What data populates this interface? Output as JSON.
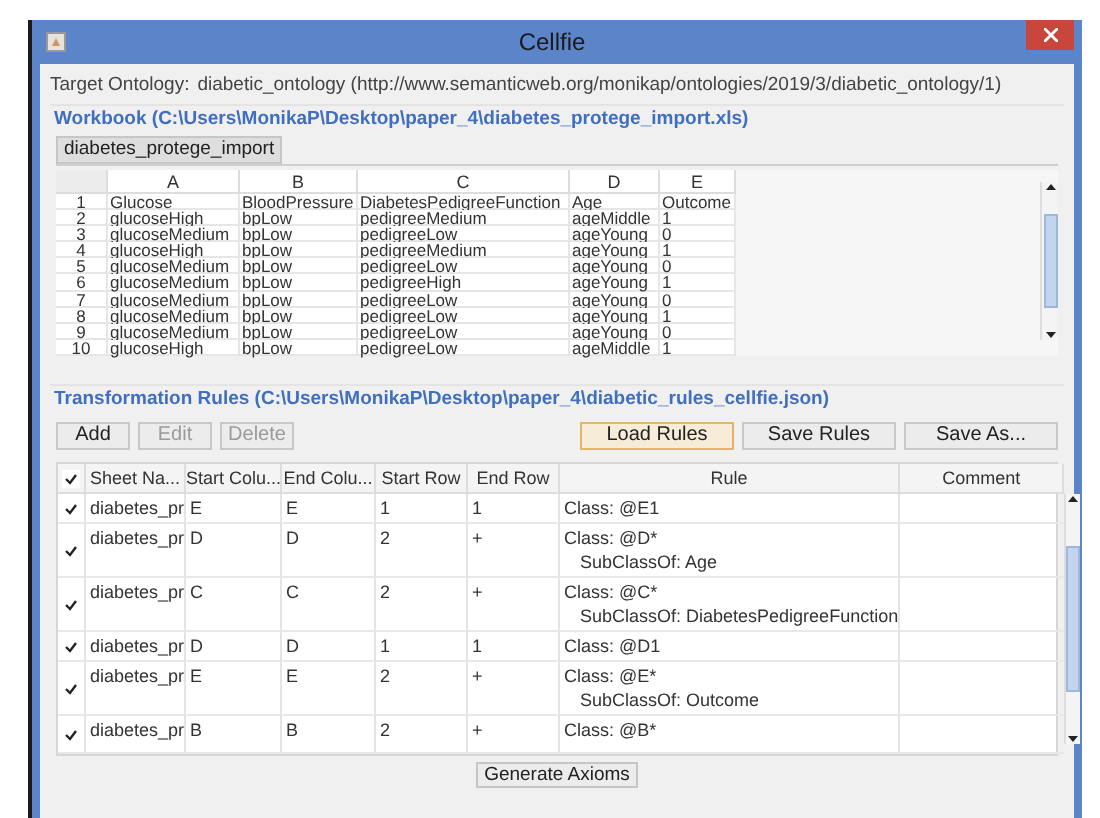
{
  "window": {
    "title": "Cellfie"
  },
  "target_ontology": {
    "label": "Target Ontology:",
    "value": "diabetic_ontology (http://www.semanticweb.org/monikap/ontologies/2019/3/diabetic_ontology/1)"
  },
  "workbook": {
    "title": "Workbook (C:\\Users\\MonikaP\\Desktop\\paper_4\\diabetes_protege_import.xls)",
    "tabs": [
      {
        "label": "diabetes_protege_import",
        "selected": true
      }
    ],
    "columns": [
      "",
      "A",
      "B",
      "C",
      "D",
      "E"
    ],
    "rows": [
      [
        "1",
        "Glucose",
        "BloodPressure",
        "DiabetesPedigreeFunction",
        "Age",
        "Outcome"
      ],
      [
        "2",
        "glucoseHigh",
        "bpLow",
        "pedigreeMedium",
        "ageMiddle",
        "1"
      ],
      [
        "3",
        "glucoseMedium",
        "bpLow",
        "pedigreeLow",
        "ageYoung",
        "0"
      ],
      [
        "4",
        "glucoseHigh",
        "bpLow",
        "pedigreeMedium",
        "ageYoung",
        "1"
      ],
      [
        "5",
        "glucoseMedium",
        "bpLow",
        "pedigreeLow",
        "ageYoung",
        "0"
      ],
      [
        "6",
        "glucoseMedium",
        "bpLow",
        "pedigreeHigh",
        "ageYoung",
        "1"
      ],
      [
        "7",
        "glucoseMedium",
        "bpLow",
        "pedigreeLow",
        "ageYoung",
        "0"
      ],
      [
        "8",
        "glucoseMedium",
        "bpLow",
        "pedigreeLow",
        "ageYoung",
        "1"
      ],
      [
        "9",
        "glucoseMedium",
        "bpLow",
        "pedigreeLow",
        "ageYoung",
        "0"
      ],
      [
        "10",
        "glucoseHigh",
        "bpLow",
        "pedigreeLow",
        "ageMiddle",
        "1"
      ]
    ]
  },
  "rules": {
    "title": "Transformation Rules (C:\\Users\\MonikaP\\Desktop\\paper_4\\diabetic_rules_cellfie.json)",
    "buttons": [
      {
        "label": "Add",
        "disabled": false,
        "focused": false
      },
      {
        "label": "Edit",
        "disabled": true,
        "focused": false
      },
      {
        "label": "Delete",
        "disabled": true,
        "focused": false
      }
    ],
    "file_buttons": [
      {
        "label": "Load Rules",
        "disabled": false,
        "focused": true
      },
      {
        "label": "Save Rules",
        "disabled": false,
        "focused": false
      },
      {
        "label": "Save As...",
        "disabled": false,
        "focused": false
      }
    ],
    "header_checked": true,
    "columns": [
      "Sheet Na...",
      "Start Colu...",
      "End Colu...",
      "Start Row",
      "End Row",
      "Rule",
      "Comment"
    ],
    "rows": [
      {
        "checked": true,
        "cells": [
          "diabetes_pr",
          "E",
          "E",
          "1",
          "1"
        ],
        "rule": [
          "Class: @E1"
        ]
      },
      {
        "checked": true,
        "cells": [
          "diabetes_pr",
          "D",
          "D",
          "2",
          "+"
        ],
        "rule": [
          "Class: @D*",
          "SubClassOf: Age"
        ]
      },
      {
        "checked": true,
        "cells": [
          "diabetes_pr",
          "C",
          "C",
          "2",
          "+"
        ],
        "rule": [
          "Class: @C*",
          "SubClassOf: DiabetesPedigreeFunction"
        ]
      },
      {
        "checked": true,
        "cells": [
          "diabetes_pr",
          "D",
          "D",
          "1",
          "1"
        ],
        "rule": [
          "Class: @D1"
        ]
      },
      {
        "checked": true,
        "cells": [
          "diabetes_pr",
          "E",
          "E",
          "2",
          "+"
        ],
        "rule": [
          "Class: @E*",
          "SubClassOf: Outcome"
        ]
      },
      {
        "checked": true,
        "cells": [
          "diabetes_pr",
          "B",
          "B",
          "2",
          "+"
        ],
        "rule": [
          "Class: @B*"
        ]
      }
    ]
  },
  "generate_button": "Generate Axioms"
}
